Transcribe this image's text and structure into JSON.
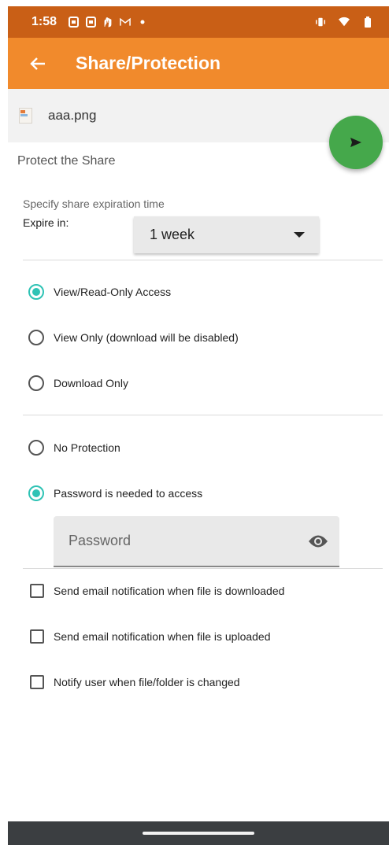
{
  "status_bar": {
    "time": "1:58",
    "left_icons": [
      "sim-icon",
      "sim-icon",
      "gesture-icon",
      "gmail-icon",
      "dot-icon"
    ],
    "right_icons": [
      "vibrate-icon",
      "wifi-icon",
      "battery-icon"
    ]
  },
  "app_bar": {
    "title": "Share/Protection",
    "back_icon": "arrow-left-icon"
  },
  "file": {
    "name": "aaa.png",
    "icon": "image-file-icon"
  },
  "fab": {
    "icon": "send-icon",
    "color": "#45a84b"
  },
  "protect": {
    "section_title": "Protect the Share",
    "expire_caption": "Specify share expiration time",
    "expire_label": "Expire in:",
    "expire_value": "1 week"
  },
  "access_options": [
    {
      "label": "View/Read-Only Access",
      "selected": true
    },
    {
      "label": "View Only (download will be disabled)",
      "selected": false
    },
    {
      "label": "Download Only",
      "selected": false
    }
  ],
  "protection_options": [
    {
      "label": "No Protection",
      "selected": false
    },
    {
      "label": "Password is needed to access",
      "selected": true
    }
  ],
  "password": {
    "placeholder": "Password",
    "toggle_icon": "eye-icon"
  },
  "notifications": [
    {
      "label": "Send email notification when file is downloaded",
      "checked": false
    },
    {
      "label": "Send email notification when file is uploaded",
      "checked": false
    },
    {
      "label": "Notify user when file/folder is changed",
      "checked": false
    }
  ],
  "colors": {
    "status_bar": "#c95f16",
    "app_bar": "#f18a2c",
    "accent": "#2fc3b5",
    "nav_bar": "#3b3e41"
  }
}
